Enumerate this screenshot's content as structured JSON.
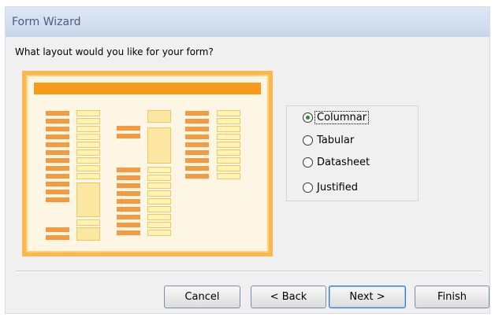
{
  "window": {
    "title": "Form Wizard"
  },
  "prompt": "What layout would you like for your form?",
  "layout_options": [
    {
      "label": "Columnar",
      "selected": true
    },
    {
      "label": "Tabular",
      "selected": false
    },
    {
      "label": "Datasheet",
      "selected": false
    },
    {
      "label": "Justified",
      "selected": false
    }
  ],
  "buttons": {
    "cancel": "Cancel",
    "back": "< Back",
    "next": "Next >",
    "finish": "Finish"
  },
  "colors": {
    "preview_border": "#fcb64e",
    "preview_header": "#f89b1c",
    "label_bar": "#f59a40",
    "field_fill": "#fff3b8",
    "selected_radio": "#2d8a2d"
  }
}
